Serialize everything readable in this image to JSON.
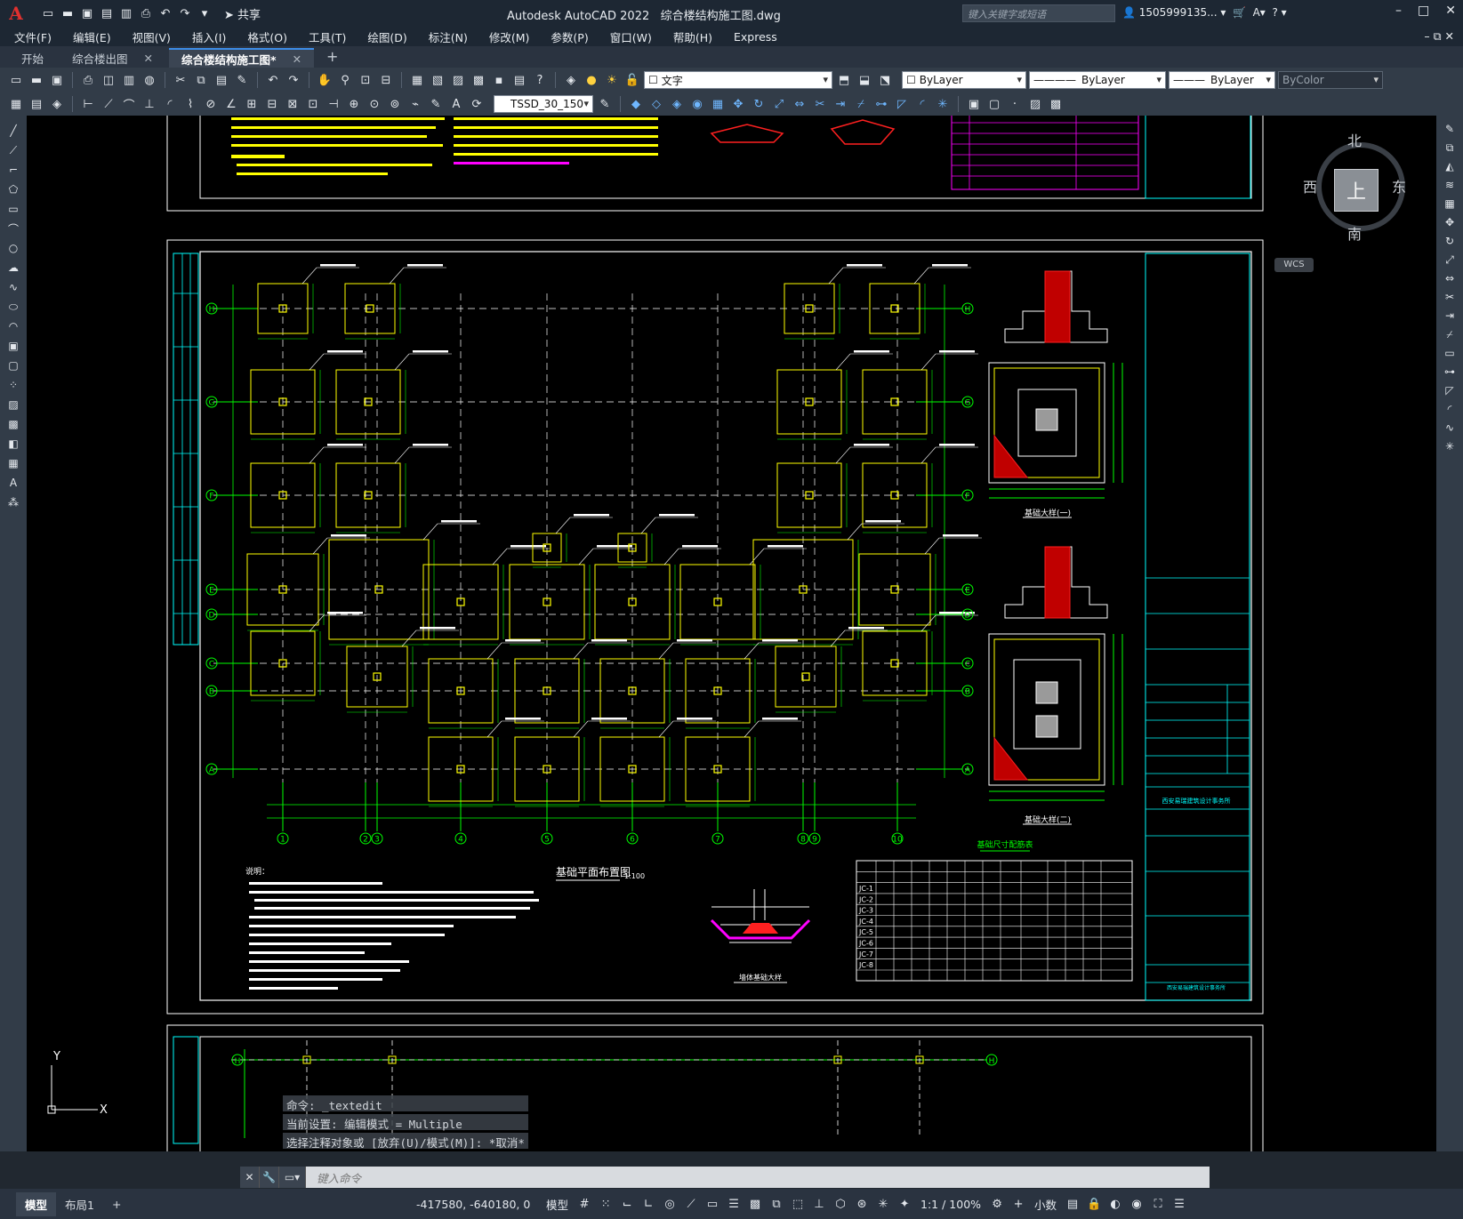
{
  "app": {
    "logo": "A",
    "title": "Autodesk AutoCAD 2022",
    "filename": "综合楼结构施工图.dwg",
    "share_label": "共享",
    "search_placeholder": "键入关键字或短语",
    "user": "1505999135...",
    "window_buttons": [
      "–",
      "□",
      "✕"
    ]
  },
  "menu": [
    "文件(F)",
    "编辑(E)",
    "视图(V)",
    "插入(I)",
    "格式(O)",
    "工具(T)",
    "绘图(D)",
    "标注(N)",
    "修改(M)",
    "参数(P)",
    "窗口(W)",
    "帮助(H)",
    "Express"
  ],
  "tabs": [
    {
      "label": "开始",
      "closable": false
    },
    {
      "label": "综合楼出图",
      "closable": true
    },
    {
      "label": "综合楼结构施工图*",
      "closable": true,
      "active": true
    }
  ],
  "toolbar": {
    "layer_value": "文字",
    "dimstyle_value": "TSSD_30_150",
    "color_value": "ByLayer",
    "linetype_value": "ByLayer",
    "lineweight_value": "ByLayer",
    "plotstyle_value": "ByColor"
  },
  "viewcube": {
    "north": "北",
    "south": "南",
    "east": "东",
    "west": "西",
    "face": "上",
    "wcs": "WCS"
  },
  "drawing": {
    "plan_title": "基础平面布置图",
    "plan_scale": "1:100",
    "detail1_title": "基础大样(一)",
    "detail2_title": "基础大样(二)",
    "wall_detail_title": "墙体基础大样",
    "table_title": "基础尺寸配筋表",
    "notes_title": "说明：",
    "grid_rows": [
      "H",
      "G",
      "F",
      "E",
      "D",
      "C",
      "B",
      "A"
    ],
    "grid_cols": [
      "1",
      "2",
      "3",
      "4",
      "5",
      "6",
      "7",
      "8",
      "9",
      "10"
    ],
    "table_rows": [
      "JC-1",
      "JC-2",
      "JC-3",
      "JC-4",
      "JC-5",
      "JC-6",
      "JC-7",
      "JC-8"
    ],
    "company": "西安易瑞建筑设计事务所"
  },
  "command": {
    "history": [
      "命令: _textedit",
      "当前设置: 编辑模式 = Multiple",
      "选择注释对象或 [放弃(U)/模式(M)]: *取消*"
    ],
    "placeholder": "键入命令"
  },
  "status": {
    "tabs": [
      "模型",
      "布局1"
    ],
    "coords": "-417580, -640180, 0",
    "model_label": "模型",
    "scale": "1:1 / 100%",
    "units": "小数"
  },
  "colors": {
    "yellow": "#ffff00",
    "green": "#00ff00",
    "cyan": "#00ffff",
    "magenta": "#ff00ff",
    "red": "#ff2020",
    "white": "#ffffff"
  }
}
